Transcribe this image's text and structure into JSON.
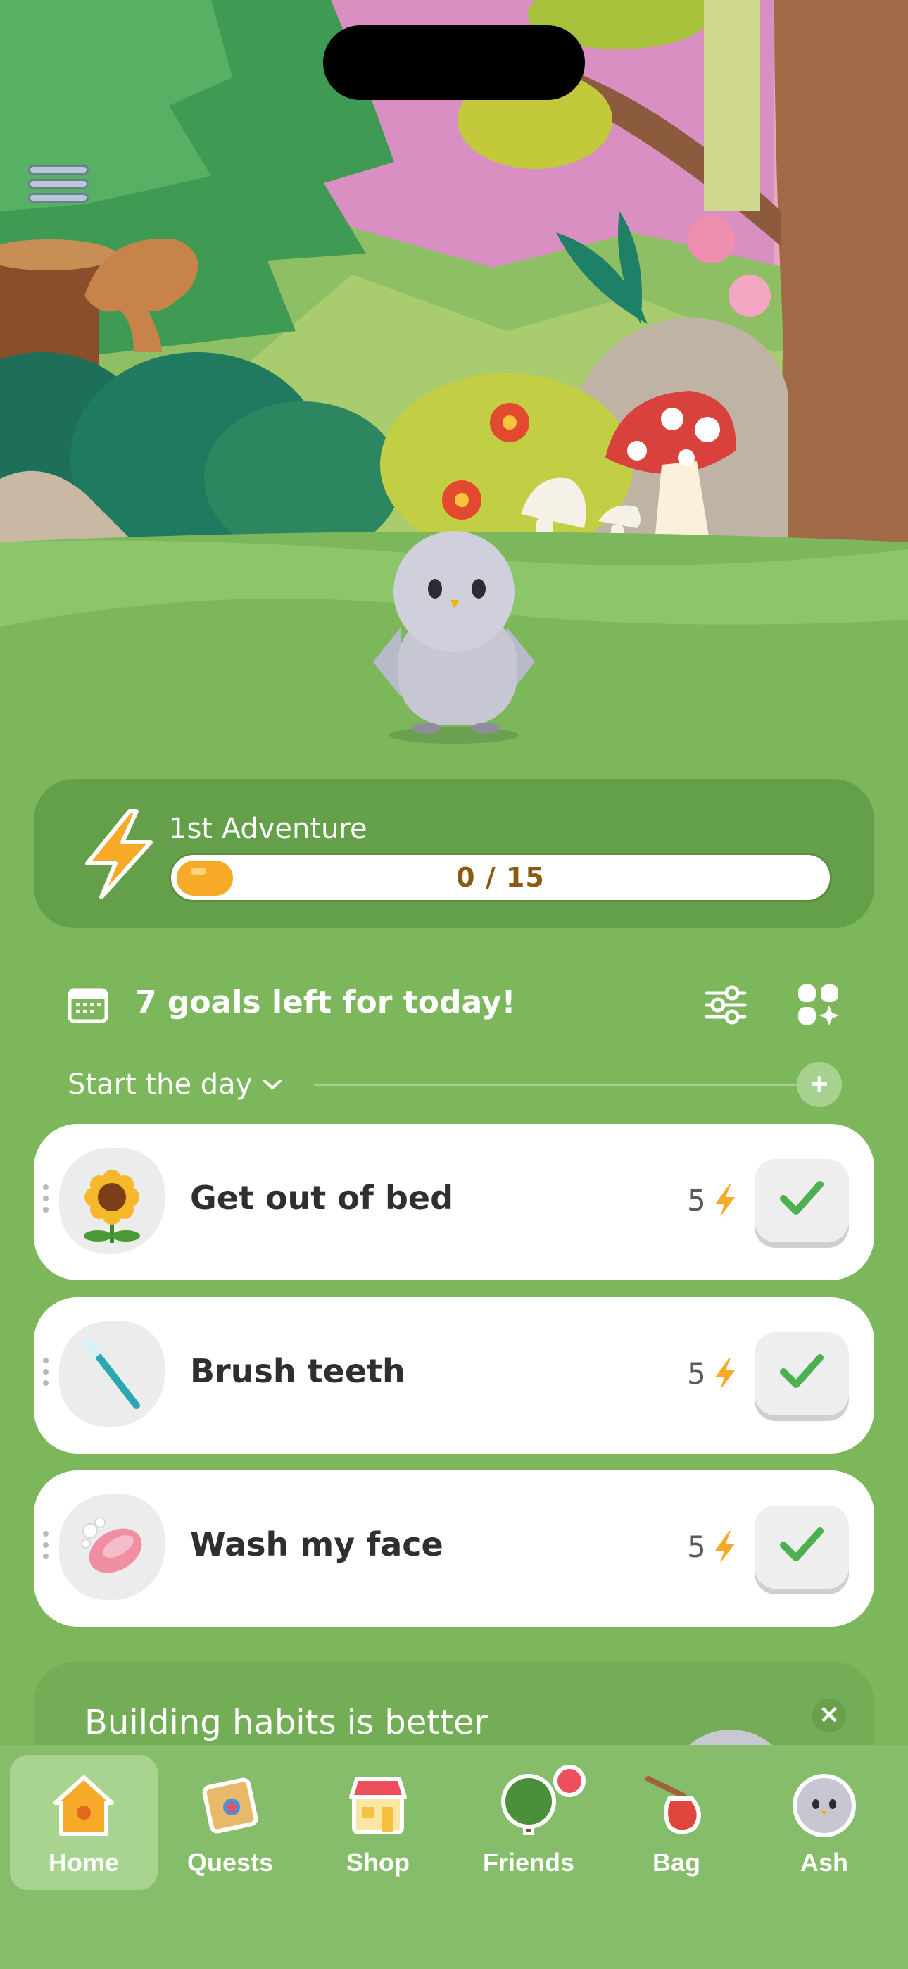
{
  "adventure": {
    "title": "1st Adventure",
    "progress_text": "0 / 15",
    "progress_fraction": 0.0
  },
  "goals": {
    "summary": "7 goals left for today!"
  },
  "section": {
    "label": "Start the day"
  },
  "habits": [
    {
      "name": "Get out of bed",
      "points": "5",
      "icon": "sunflower-icon"
    },
    {
      "name": "Brush teeth",
      "points": "5",
      "icon": "toothbrush-icon"
    },
    {
      "name": "Wash my face",
      "points": "5",
      "icon": "soap-icon"
    }
  ],
  "promo": {
    "text": "Building habits is better",
    "close": "✕"
  },
  "add_label": "+",
  "tabs": [
    {
      "label": "Home",
      "icon": "house-icon",
      "active": true
    },
    {
      "label": "Quests",
      "icon": "quest-map-icon"
    },
    {
      "label": "Shop",
      "icon": "shop-icon"
    },
    {
      "label": "Friends",
      "icon": "tree-icon",
      "badge": true
    },
    {
      "label": "Bag",
      "icon": "bag-icon"
    },
    {
      "label": "Ash",
      "icon": "bird-avatar-icon"
    }
  ],
  "colors": {
    "background_green": "#7db75c",
    "accent_orange": "#f7a928",
    "check_green": "#4caf50"
  }
}
